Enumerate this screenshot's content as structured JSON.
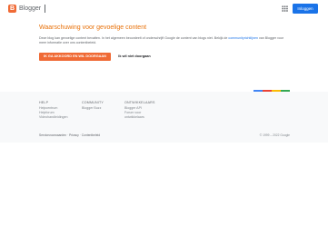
{
  "header": {
    "brand": "Blogger",
    "logo_letter": "B",
    "sign_in": "Inloggen"
  },
  "main": {
    "title": "Waarschuwing voor gevoelige content",
    "text_before_link": "Deze blog kan gevoelige content bevatten. In het algemeen beoordeelt of onderschrijft Google de content van blogs niet. Bekijk de ",
    "link": "communityrichtlijnen",
    "text_after_link": " van Blogger voor meer informatie over ons contentbeleid.",
    "agree_button": "Ik ga akkoord en wil doorgaan",
    "decline_button": "Ik wil niet doorgaan"
  },
  "footer": {
    "columns": [
      {
        "heading": "Help",
        "links": [
          "Helpcentrum",
          "Helpforum",
          "Videohandleidingen"
        ]
      },
      {
        "heading": "Community",
        "links": [
          "Blogger Buzz"
        ]
      },
      {
        "heading": "Ontwikkelaars",
        "links": [
          "Blogger API",
          "Forum voor",
          "ontwikkelaars"
        ]
      }
    ],
    "bottom_links": [
      "Servicevoorwaarden",
      "Privacy",
      "Contentbeleid"
    ],
    "copyright": "© 1999 – 2022 Google"
  },
  "colors": {
    "blogger_orange": "#f06a35",
    "title_orange": "#e8710a",
    "signin_blue": "#1a73e8",
    "google_colorbar": [
      "#4285f4",
      "#ea4335",
      "#fbbc05",
      "#34a853"
    ]
  }
}
